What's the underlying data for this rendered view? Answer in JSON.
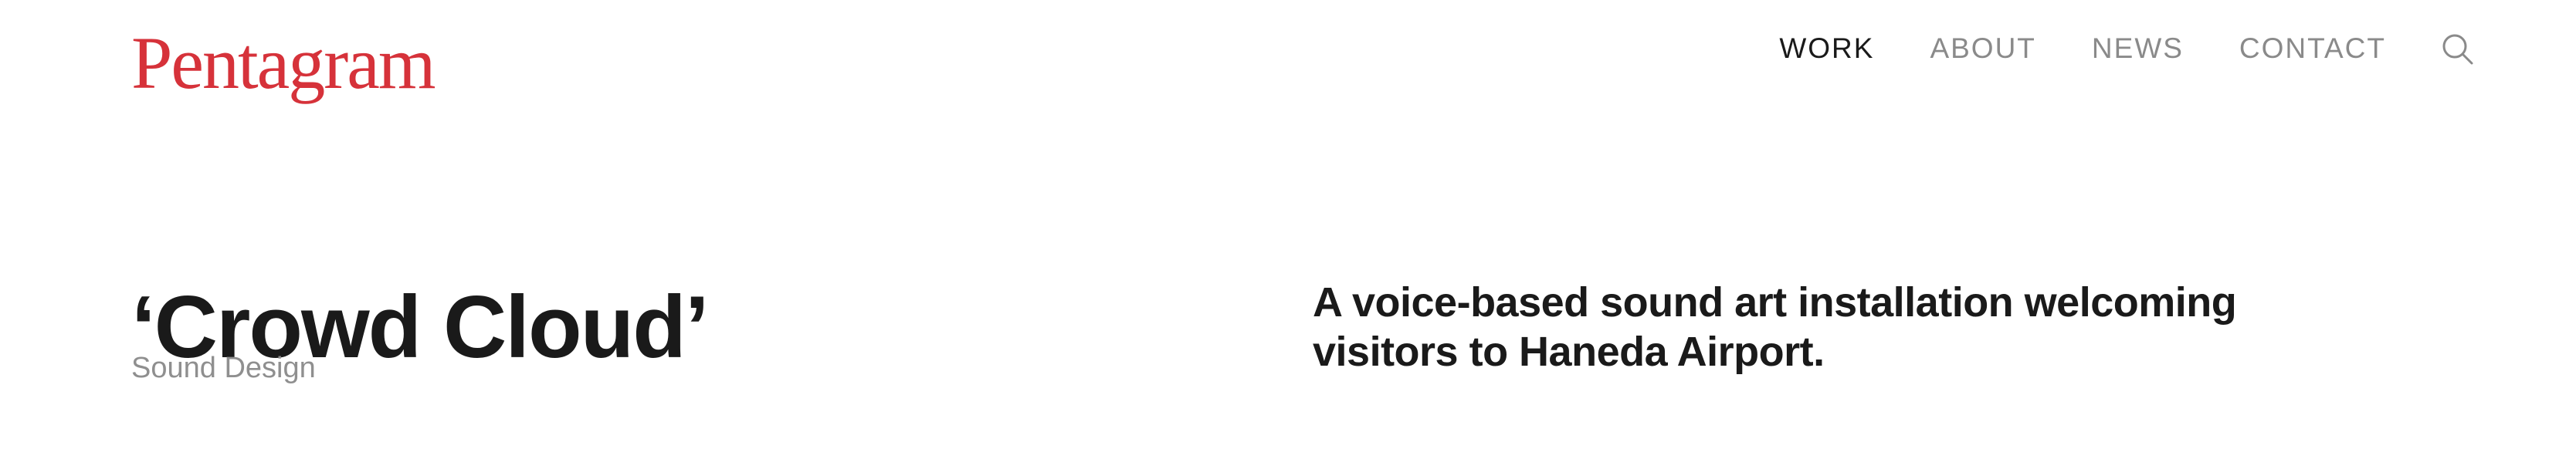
{
  "header": {
    "logo_text": "Pentagram",
    "nav": {
      "work": "WORK",
      "about": "ABOUT",
      "news": "NEWS",
      "contact": "CONTACT"
    },
    "search_icon": "search-icon"
  },
  "project": {
    "title": "‘Crowd Cloud’",
    "category": "Sound Design",
    "description_lines": [
      "A voice-based sound art installation welcoming",
      "visitors to Haneda Airport."
    ]
  },
  "colors": {
    "brand": "#d6323a",
    "text": "#1a1a1a",
    "muted": "#8a8a8a"
  }
}
